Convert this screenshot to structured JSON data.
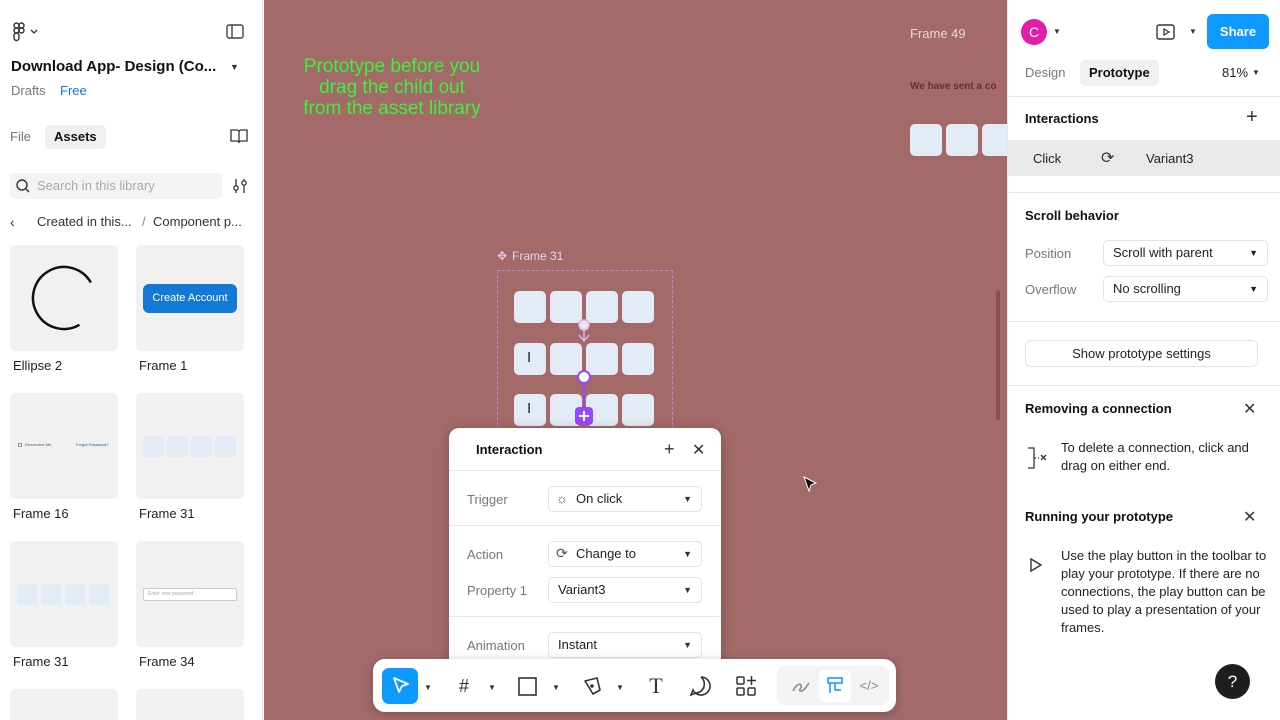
{
  "left": {
    "project_title": "Download App- Design (Co...",
    "drafts": "Drafts",
    "plan": "Free",
    "tabs": [
      "File",
      "Assets"
    ],
    "search_placeholder": "Search in this library",
    "breadcrumb": [
      "Created in this...",
      "/",
      "Component p..."
    ],
    "thumbs": [
      {
        "label": "Ellipse 2"
      },
      {
        "label": "Frame 1",
        "button": "Create Account"
      },
      {
        "label": "Frame 16",
        "mini_left": "Remember Me",
        "mini_right": "Forgot Password?"
      },
      {
        "label": "Frame 31"
      },
      {
        "label": "Frame 31"
      },
      {
        "label": "Frame 34",
        "mini_input": "Enter new password"
      }
    ]
  },
  "canvas": {
    "note": "Prototype before you drag the child out from the asset library",
    "frame49": "Frame 49",
    "sent_text": "We have sent a co",
    "frame31_label": "Frame 31",
    "cursor_chars": [
      "I",
      "I"
    ]
  },
  "popup": {
    "title": "Interaction",
    "trigger_label": "Trigger",
    "trigger_value": "On click",
    "action_label": "Action",
    "action_value": "Change to",
    "property_label": "Property 1",
    "property_value": "Variant3",
    "animation_label": "Animation",
    "animation_value": "Instant"
  },
  "right": {
    "avatar_letter": "C",
    "share": "Share",
    "tabs": [
      "Design",
      "Prototype"
    ],
    "zoom": "81%",
    "interactions_title": "Interactions",
    "interaction_trigger": "Click",
    "interaction_target": "Variant3",
    "scroll_title": "Scroll behavior",
    "position_label": "Position",
    "position_value": "Scroll with parent",
    "overflow_label": "Overflow",
    "overflow_value": "No scrolling",
    "settings_button": "Show prototype settings",
    "removing_title": "Removing a connection",
    "removing_text": "To delete a connection, click and drag on either end.",
    "running_title": "Running your prototype",
    "running_text": "Use the play button in the toolbar to play your prototype. If there are no connections, the play button can be used to play a presentation of your frames.",
    "help": "?"
  },
  "colors": {
    "canvas": "#a46a6a",
    "accent": "#0d99ff",
    "note": "#3af23a",
    "prototype_purple": "#9747ff"
  }
}
